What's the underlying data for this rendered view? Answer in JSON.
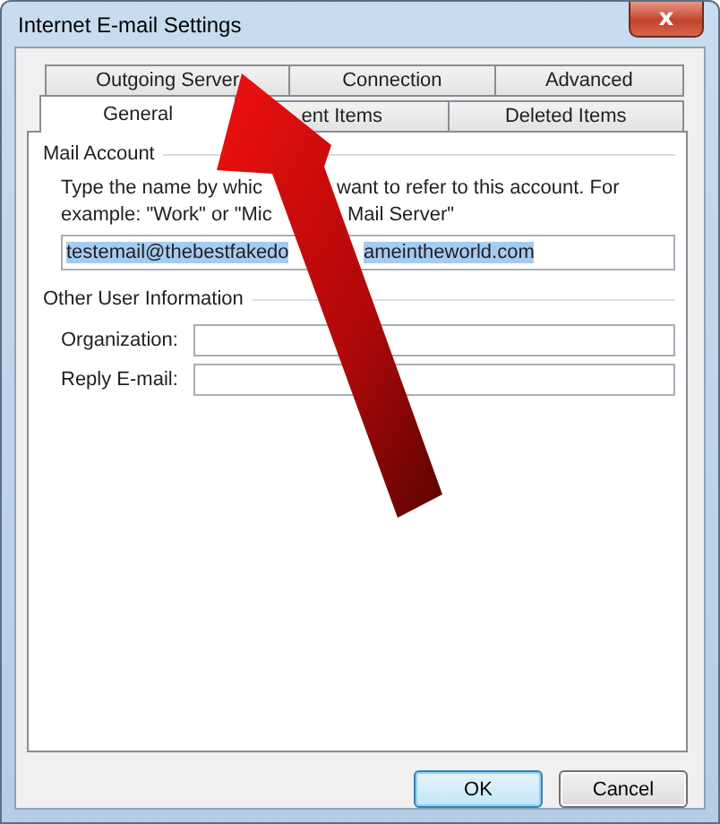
{
  "window": {
    "title": "Internet E-mail Settings",
    "close_label": "x"
  },
  "tab_rows": [
    [
      {
        "label": "Outgoing Server",
        "selected": false
      },
      {
        "label": "Connection",
        "selected": false
      },
      {
        "label": "Advanced",
        "selected": false
      }
    ],
    [
      {
        "label": "General",
        "selected": true
      },
      {
        "label": "ent Items",
        "selected": false
      },
      {
        "label": "Deleted Items",
        "selected": false
      }
    ]
  ],
  "mail_account": {
    "heading": "Mail Account",
    "description_lines": [
      [
        "Type the name by whic",
        "want to refer to this account. For"
      ],
      [
        "example: \"Work\" or \"Mic",
        "Mail Server\""
      ]
    ],
    "account_name_parts": [
      "testemail@thebestfakedo",
      "ameintheworld.com"
    ]
  },
  "other_user_information": {
    "heading": "Other User Information",
    "fields": [
      {
        "label": "Organization:"
      },
      {
        "label": "Reply E-mail:"
      }
    ]
  },
  "buttons": [
    {
      "label": "OK",
      "default": true
    },
    {
      "label": "Cancel",
      "default": false
    }
  ]
}
